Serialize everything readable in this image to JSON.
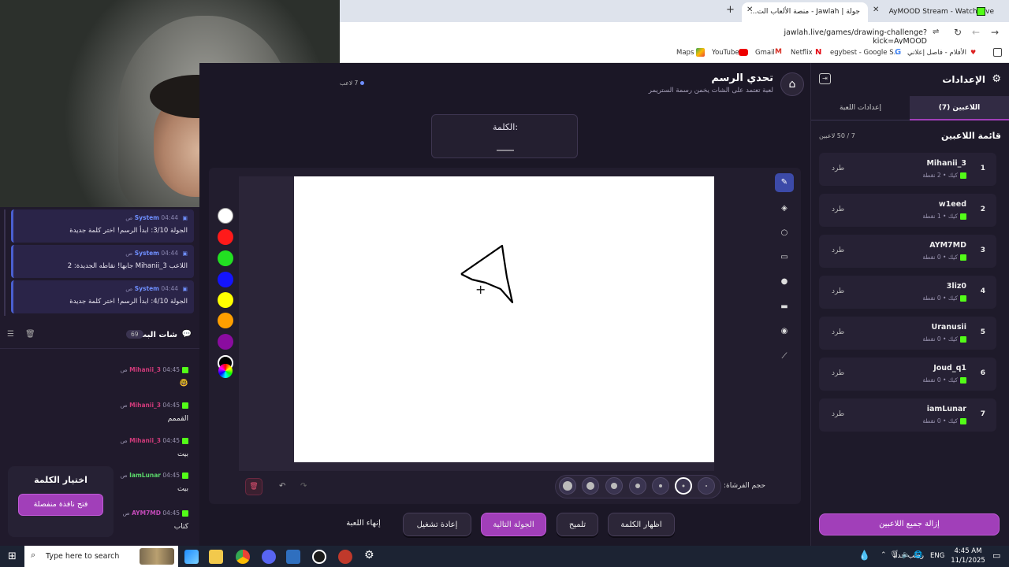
{
  "browser": {
    "tabs": [
      {
        "title": "AyMOOD Stream - Watch Live"
      },
      {
        "title": "جولة | Jawlah - منصة الألعاب الت..."
      }
    ],
    "url": "jawlah.live/games/drawing-challenge?kick=AyMOOD",
    "bookmarks": [
      "Maps",
      "YouTube",
      "Gmail",
      "Netflix",
      "egybest - Google S...",
      "الأفلام - فاصل إعلاني"
    ]
  },
  "stream_chat": {
    "system_messages": [
      {
        "sender": "System",
        "time": "04:44 ص",
        "text": "الجولة 3/10: ابدأ الرسم! اختر كلمة جديدة"
      },
      {
        "sender": "System",
        "time": "04:44 ص",
        "text": "اللاعب Mihanii_3 جابها! نقاطه الجديدة: 2"
      },
      {
        "sender": "System",
        "time": "04:44 ص",
        "text": "الجولة 4/10: ابدأ الرسم! اختر كلمة جديدة"
      }
    ],
    "title": "شات البث",
    "viewer_count": "69",
    "messages": [
      {
        "user": "Mihanii_3",
        "time": "04:45 ص",
        "text": "🤓"
      },
      {
        "user": "Mihanii_3",
        "time": "04:45 ص",
        "text": "القممم"
      },
      {
        "user": "Mihanii_3",
        "time": "04:45 ص",
        "text": "بيت"
      },
      {
        "user": "IamLunar",
        "time": "04:45 ص",
        "text": "بيت"
      },
      {
        "user": "AYM7MD",
        "time": "04:45 ص",
        "text": "كتاب"
      }
    ]
  },
  "word_picker": {
    "title": "اختيار الكلمة",
    "button": "فتح نافذة منفصلة"
  },
  "game": {
    "title": "تحدي الرسم",
    "subtitle": "لعبة تعتمد على الشات يخمن رسمة الستريمر",
    "online_count": "7 لاعب",
    "word_label": "الكلمة:",
    "word_blank": "____",
    "brush_size_label": "حجم الفرشاة:",
    "colors": [
      "#ffffff",
      "#ff1a1a",
      "#22e022",
      "#1414ff",
      "#ffff00",
      "#ff9f00",
      "#8a0ca0",
      "#000000"
    ],
    "actions": {
      "end": "إنهاء اللعبة",
      "restart": "إعادة تشغيل",
      "next": "الجولة التالية",
      "hint": "تلميح",
      "reveal": "اظهار الكلمة"
    }
  },
  "settings": {
    "title": "الإعدادات",
    "tab_players": "اللاعبين (7)",
    "tab_game": "إعدادات اللعبة",
    "list_title": "قائمة اللاعبين",
    "capacity": "7 / 50 لاعبين",
    "kick_label": "طرد",
    "platform": "كيك",
    "players": [
      {
        "rank": "1",
        "name": "Mihanii_3",
        "points": "2 نقطة"
      },
      {
        "rank": "2",
        "name": "w1eed",
        "points": "1 نقطة"
      },
      {
        "rank": "3",
        "name": "AYM7MD",
        "points": "0 نقطة"
      },
      {
        "rank": "4",
        "name": "3liz0",
        "points": "0 نقطة"
      },
      {
        "rank": "5",
        "name": "Uranusii",
        "points": "0 نقطة"
      },
      {
        "rank": "6",
        "name": "Joud_q1",
        "points": "0 نقطة"
      },
      {
        "rank": "7",
        "name": "iamLunar",
        "points": "0 نقطة"
      }
    ],
    "remove_all": "إزالة جميع اللاعبين"
  },
  "taskbar": {
    "search_placeholder": "Type here to search",
    "weather": "رطب جداً",
    "language": "ENG",
    "time": "4:45 AM",
    "date": "11/1/2025"
  },
  "accent": "#a13fb9",
  "kick_green": "#53fc18"
}
